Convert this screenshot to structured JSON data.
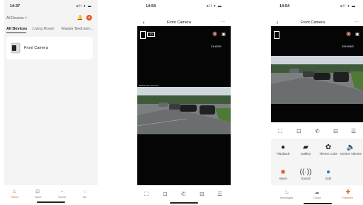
{
  "home": {
    "status_time": "14:37",
    "status_icons": "all ▾ ▬",
    "location_label": "All Devices ˅",
    "tabs": [
      "All Devices",
      "Living Room",
      "Master Bedroom",
      "..."
    ],
    "device_name": "Front Camera",
    "bottom_nav": [
      "Home",
      "Store",
      "Scene",
      "Me"
    ]
  },
  "live": {
    "status_time": "14:54",
    "status_icons": "all ▾ ▬",
    "title": "Front Camera",
    "more": "···",
    "quality": "1D",
    "speed": "31 KB/S",
    "timestamp": "2020-04-21 14:54:23"
  },
  "live_expanded": {
    "status_time": "14:54",
    "status_icons": "all ▾ ▬",
    "title": "Front Camera",
    "more": "···",
    "speed": "299 KB/S",
    "features": [
      {
        "icon": "playback-icon",
        "label": "Playback"
      },
      {
        "icon": "gallery-icon",
        "label": "Gallery"
      },
      {
        "icon": "theme-icon",
        "label": "Theme Color"
      },
      {
        "icon": "volume-icon",
        "label": "Device Volume"
      }
    ],
    "extra_features": [
      {
        "icon": "alarm-icon",
        "label": "Alarm"
      },
      {
        "icon": "sound-icon",
        "label": "Sound"
      },
      {
        "icon": "edit-icon",
        "label": "Edit"
      }
    ],
    "bottom_nav": [
      "Messages",
      "Cloud",
      "Features"
    ]
  },
  "colors": {
    "accent": "#e8572a",
    "blue": "#2a7de1"
  }
}
